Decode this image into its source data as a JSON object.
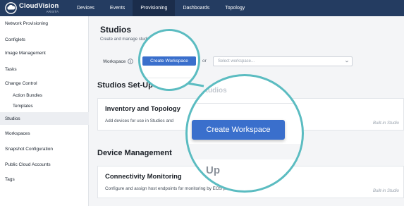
{
  "brand": {
    "name": "CloudVision",
    "sub": "ARISTA"
  },
  "topnav": {
    "items": [
      {
        "label": "Devices",
        "active": false
      },
      {
        "label": "Events",
        "active": false
      },
      {
        "label": "Provisioning",
        "active": true
      },
      {
        "label": "Dashboards",
        "active": false
      },
      {
        "label": "Topology",
        "active": false
      }
    ]
  },
  "sidebar": {
    "items": [
      {
        "label": "Network Provisioning"
      },
      {
        "label": "Configlets"
      },
      {
        "label": "Image Management"
      },
      {
        "label": "Tasks"
      },
      {
        "label": "Change Control"
      },
      {
        "label": "Action Bundles"
      },
      {
        "label": "Templates"
      },
      {
        "label": "Studios"
      },
      {
        "label": "Workspaces"
      },
      {
        "label": "Snapshot Configuration"
      },
      {
        "label": "Public Cloud Accounts"
      },
      {
        "label": "Tags"
      }
    ],
    "active": "Studios"
  },
  "main": {
    "title": "Studios",
    "subtitle": "Create and manage studios",
    "workspace_label": "Workspace",
    "create_button": "Create Workspace",
    "or_text": "or",
    "select_placeholder": "Select workspace...",
    "sections": [
      {
        "title": "Studios Set-Up",
        "card": {
          "title": "Inventory and Topology",
          "description": "Add devices for use in Studios and",
          "badge": "Built-in Studio"
        }
      },
      {
        "title": "Device Management",
        "card": {
          "title": "Connectivity Monitoring",
          "description": "Configure and assign host endpoints for monitoring by EOS probes.",
          "badge": "Built-in Studio"
        }
      }
    ]
  },
  "zoom": {
    "button": "Create Workspace",
    "ghost_heading": "Studios",
    "ghost_tail": "Up"
  },
  "colors": {
    "nav_bg": "#243c61",
    "primary": "#3a6fcc",
    "highlight_ring": "#5bbcc1"
  }
}
